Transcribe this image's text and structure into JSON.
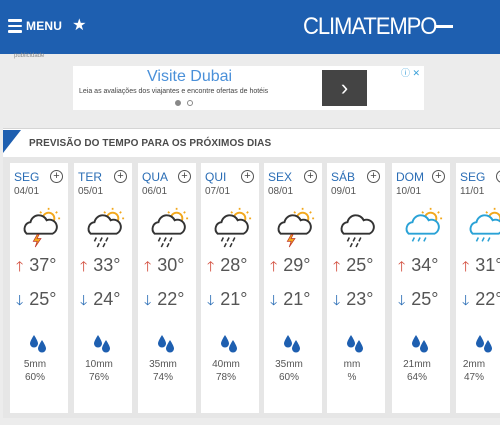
{
  "header": {
    "menu_label": "MENU",
    "logo": "CLIMATEMPO",
    "colors": {
      "brand_blue": "#1e5fb0"
    }
  },
  "ad": {
    "tag": "publicidade",
    "title": "Visite Dubai",
    "text": "Leia as avaliações dos viajantes e encontre ofertas de hotéis",
    "button_glyph": "›",
    "badges": "ⓘ ✕"
  },
  "forecast": {
    "title": "PREVISÃO DO TEMPO PARA OS PRÓXIMOS DIAS",
    "days": [
      {
        "name": "SEG",
        "date": "04/01",
        "icon": "storm-sun-icon",
        "max": "37°",
        "min": "25°",
        "rain_mm": "5mm",
        "rain_pct": "60%"
      },
      {
        "name": "TER",
        "date": "05/01",
        "icon": "cloud-rain-sun-icon",
        "max": "33°",
        "min": "24°",
        "rain_mm": "10mm",
        "rain_pct": "76%"
      },
      {
        "name": "QUA",
        "date": "06/01",
        "icon": "cloud-rain-sun-icon",
        "max": "30°",
        "min": "22°",
        "rain_mm": "35mm",
        "rain_pct": "74%"
      },
      {
        "name": "QUI",
        "date": "07/01",
        "icon": "cloud-rain-sun-icon",
        "max": "28°",
        "min": "21°",
        "rain_mm": "40mm",
        "rain_pct": "78%"
      },
      {
        "name": "SEX",
        "date": "08/01",
        "icon": "storm-sun-icon",
        "max": "29°",
        "min": "21°",
        "rain_mm": "35mm",
        "rain_pct": "60%"
      },
      {
        "name": "SÁB",
        "date": "09/01",
        "icon": "cloud-rain-icon",
        "max": "25°",
        "min": "23°",
        "rain_mm": "mm",
        "rain_pct": "%"
      },
      {
        "name": "DOM",
        "date": "10/01",
        "icon": "cloud-rain-sun-light-icon",
        "max": "34°",
        "min": "25°",
        "rain_mm": "21mm",
        "rain_pct": "64%"
      },
      {
        "name": "SEG",
        "date": "11/01",
        "icon": "cloud-rain-sun-light-icon",
        "max": "31°",
        "min": "22°",
        "rain_mm": "2mm",
        "rain_pct": "47%"
      }
    ]
  }
}
